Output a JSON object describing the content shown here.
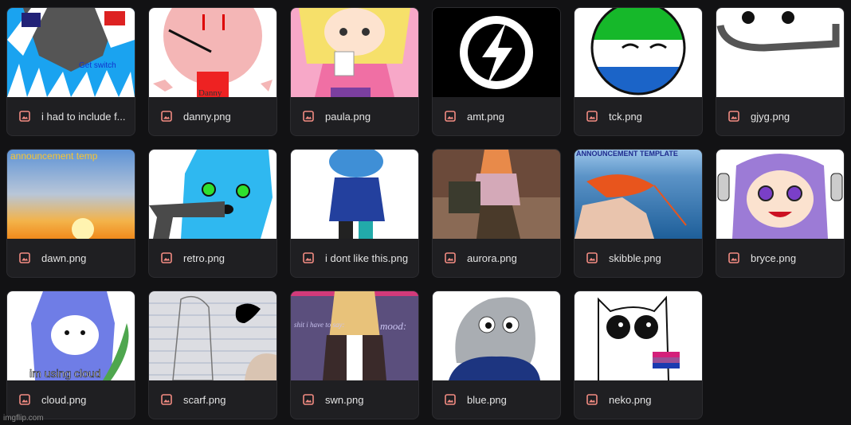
{
  "files": [
    {
      "name": "i had to include f...",
      "icon": "image-file-icon"
    },
    {
      "name": "danny.png",
      "icon": "image-file-icon"
    },
    {
      "name": "paula.png",
      "icon": "image-file-icon"
    },
    {
      "name": "amt.png",
      "icon": "image-file-icon"
    },
    {
      "name": "tck.png",
      "icon": "image-file-icon"
    },
    {
      "name": "gjyg.png",
      "icon": "image-file-icon"
    },
    {
      "name": "dawn.png",
      "icon": "image-file-icon"
    },
    {
      "name": "retro.png",
      "icon": "image-file-icon"
    },
    {
      "name": "i dont like this.png",
      "icon": "image-file-icon"
    },
    {
      "name": "aurora.png",
      "icon": "image-file-icon"
    },
    {
      "name": "skibble.png",
      "icon": "image-file-icon"
    },
    {
      "name": "bryce.png",
      "icon": "image-file-icon"
    },
    {
      "name": "cloud.png",
      "icon": "image-file-icon"
    },
    {
      "name": "scarf.png",
      "icon": "image-file-icon"
    },
    {
      "name": "swn.png",
      "icon": "image-file-icon"
    },
    {
      "name": "blue.png",
      "icon": "image-file-icon"
    },
    {
      "name": "neko.png",
      "icon": "image-file-icon"
    }
  ],
  "thumb_text": {
    "switch": "Get switch",
    "danny": "Danny",
    "dawn": "announcement temp",
    "skibble": "ANNOUNCEMENT TEMPLATE",
    "cloud": "im using cloud",
    "swn_left": "shit i have to say:",
    "swn_right": "mood:"
  },
  "colors": {
    "background": "#121214",
    "card": "#1f1f22",
    "text": "#e3e3e3",
    "icon": "#f28b82"
  },
  "watermark": "imgflip.com"
}
